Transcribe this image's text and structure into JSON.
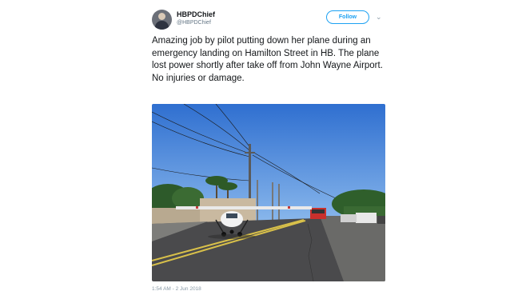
{
  "author": {
    "display_name": "HBPDChief",
    "handle": "@HBPDChief"
  },
  "follow_button": "Follow",
  "menu_icon": "chevron-down-icon",
  "tweet_text": "Amazing job by pilot putting down her plane during an emergency landing on Hamilton Street in HB. The plane lost power shortly after take off from John Wayne Airport. No injuries or damage.",
  "timestamp": "1:54 AM - 2 Jun 2018",
  "colors": {
    "accent": "#1da1f2",
    "text": "#14171a",
    "muted": "#8899a6"
  }
}
